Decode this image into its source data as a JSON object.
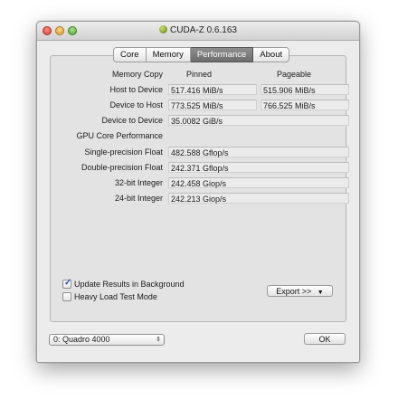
{
  "window": {
    "title": "CUDA-Z 0.6.163"
  },
  "tabs": [
    {
      "label": "Core",
      "active": false
    },
    {
      "label": "Memory",
      "active": false
    },
    {
      "label": "Performance",
      "active": true
    },
    {
      "label": "About",
      "active": false
    }
  ],
  "memory_copy": {
    "header": "Memory Copy",
    "col_pinned": "Pinned",
    "col_pageable": "Pageable",
    "rows": [
      {
        "label": "Host to Device",
        "pinned": "517.416 MiB/s",
        "pageable": "515.906 MiB/s"
      },
      {
        "label": "Device to Host",
        "pinned": "773.525 MiB/s",
        "pageable": "766.525 MiB/s"
      },
      {
        "label": "Device to Device",
        "value": "35.0082 GiB/s"
      }
    ]
  },
  "gpu_core": {
    "header": "GPU Core Performance",
    "rows": [
      {
        "label": "Single-precision Float",
        "value": "482.588 Gflop/s"
      },
      {
        "label": "Double-precision Float",
        "value": "242.371 Gflop/s"
      },
      {
        "label": "32-bit Integer",
        "value": "242.458 Giop/s"
      },
      {
        "label": "24-bit Integer",
        "value": "242.213 Giop/s"
      }
    ]
  },
  "options": {
    "update_background": {
      "label": "Update Results in Background",
      "checked": true
    },
    "heavy_load": {
      "label": "Heavy Load Test Mode",
      "checked": false
    }
  },
  "export_button": {
    "label": "Export >>",
    "icon": "chevron-down-icon"
  },
  "device_select": {
    "value": "0: Quadro 4000",
    "icon": "updown-arrows-icon"
  },
  "ok_button": {
    "label": "OK"
  },
  "colors": {
    "active_tab": "#7a7a7a",
    "window_bg": "#ececec",
    "panel_bg": "#e3e3e3"
  }
}
